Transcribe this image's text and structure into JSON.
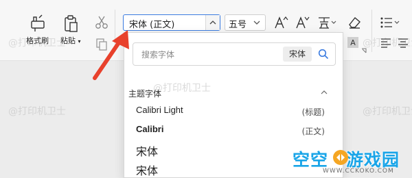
{
  "ribbon": {
    "format_painter_label": "格式刷",
    "paste_label": "粘贴",
    "font_name": "宋体 (正文)",
    "font_size": "五号"
  },
  "dropdown": {
    "search_placeholder": "搜索字体",
    "preview_text": "宋体",
    "section_title": "主题字体",
    "fonts": [
      {
        "name": "Calibri Light",
        "tag": "(标题)"
      },
      {
        "name": "Calibri",
        "tag": "(正文)"
      },
      {
        "name": "宋体",
        "tag": ""
      },
      {
        "name": "宋体",
        "tag": ""
      }
    ]
  },
  "watermark_text": "@打印机卫士",
  "brand": {
    "title_left": "空空",
    "title_right": "游戏园",
    "url": "WWW.CCKOKO.COM"
  },
  "colors": {
    "accent": "#3a7be0",
    "arrow": "#e8412c",
    "brand": "#1aa5e8"
  }
}
